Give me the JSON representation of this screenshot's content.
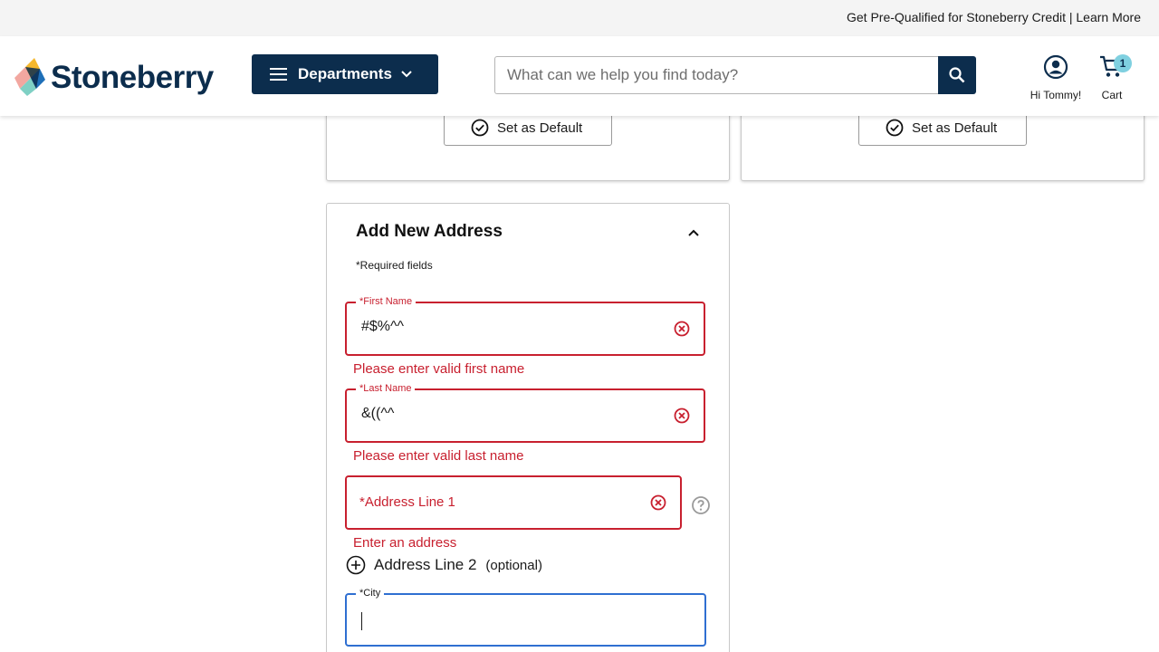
{
  "promo": {
    "text": "Get Pre-Qualified for Stoneberry Credit | Learn More"
  },
  "header": {
    "logo_text": "Stoneberry",
    "departments_label": "Departments",
    "search_placeholder": "What can we help you find today?",
    "account_label": "Hi Tommy!",
    "cart_label": "Cart",
    "cart_count": "1",
    "brand_color": "#0c2d4d",
    "badge_color": "#7fd0e0"
  },
  "saved_addresses": {
    "set_default_label": "Set as Default"
  },
  "add_address": {
    "title": "Add New Address",
    "required_note": "*Required fields",
    "first_name": {
      "label": "*First Name",
      "value": "#$%^^",
      "error": "Please enter valid first name"
    },
    "last_name": {
      "label": "*Last Name",
      "value": "&((^^",
      "error": "Please enter valid last name"
    },
    "address_line_1": {
      "placeholder": "*Address Line 1",
      "error": "Enter an address"
    },
    "address_line_2": {
      "label": "Address Line 2",
      "optional": "(optional)"
    },
    "city": {
      "label": "*City",
      "value": ""
    },
    "error_color": "#c8202f",
    "focus_color": "#2f6fd1"
  }
}
